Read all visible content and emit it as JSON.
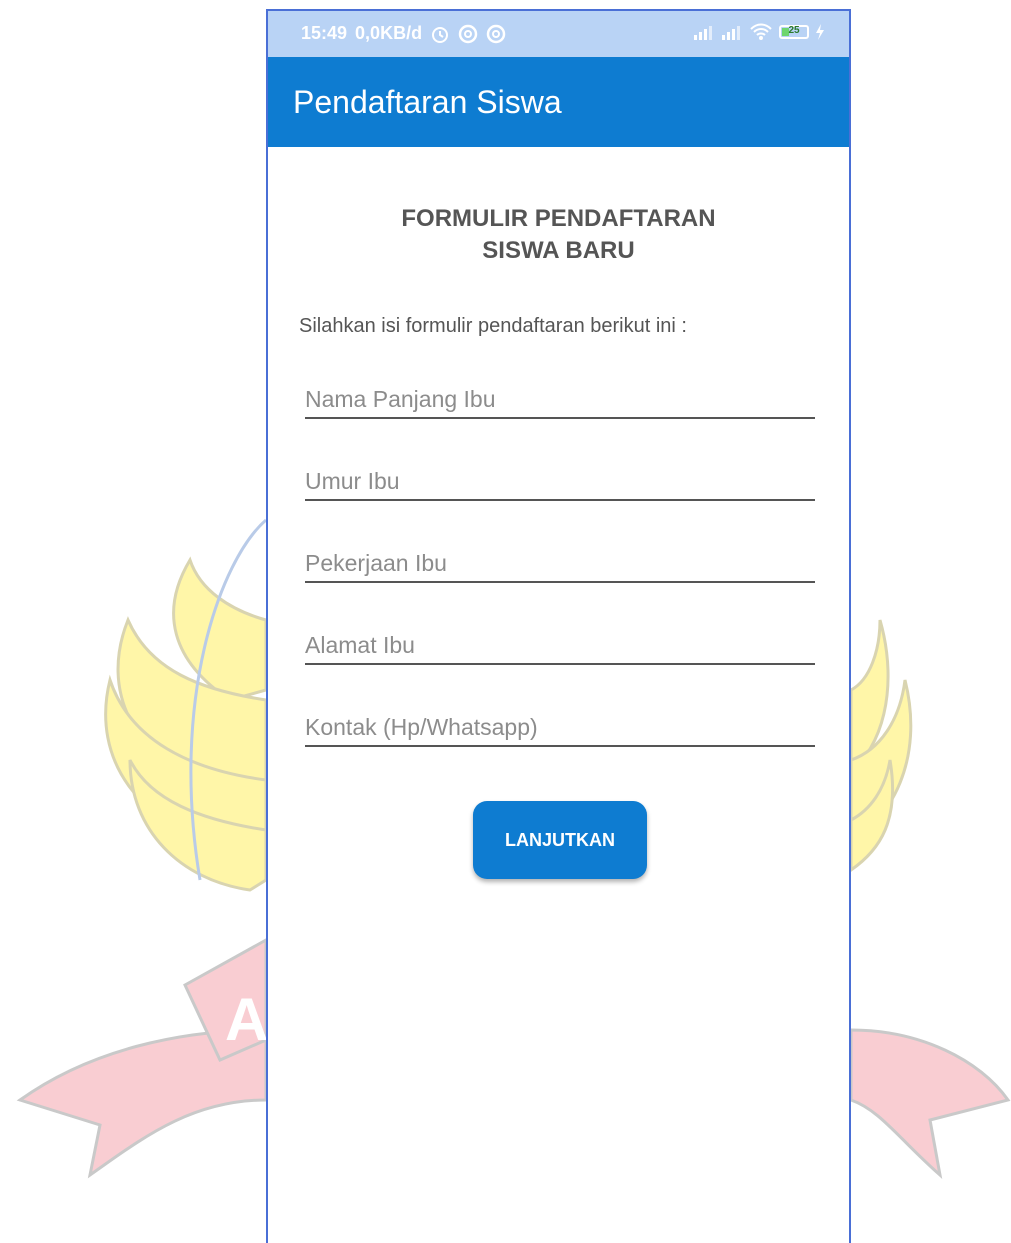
{
  "statusbar": {
    "time": "15:49",
    "speed": "0,0KB/d",
    "battery": "25",
    "icons": [
      "alarm-icon",
      "sync-icon",
      "sync-icon",
      "signal-icon",
      "signal-icon",
      "wifi-icon",
      "battery-icon",
      "charging-icon"
    ]
  },
  "appbar": {
    "title": "Pendaftaran Siswa"
  },
  "form": {
    "title": "FORMULIR PENDAFTARAN\nSISWA BARU",
    "instruction": "Silahkan isi formulir pendaftaran berikut ini :",
    "fields": [
      {
        "placeholder": "Nama Panjang Ibu",
        "value": ""
      },
      {
        "placeholder": "Umur Ibu",
        "value": ""
      },
      {
        "placeholder": "Pekerjaan Ibu",
        "value": ""
      },
      {
        "placeholder": "Alamat Ibu",
        "value": ""
      },
      {
        "placeholder": "Kontak (Hp/Whatsapp)",
        "value": ""
      }
    ],
    "submit_label": "LANJUTKAN"
  },
  "colors": {
    "primary": "#0e7cd1",
    "statusbar": "#b9d3f5",
    "watermark_yellow": "#fff4a0",
    "watermark_red": "#f7c4c9"
  }
}
